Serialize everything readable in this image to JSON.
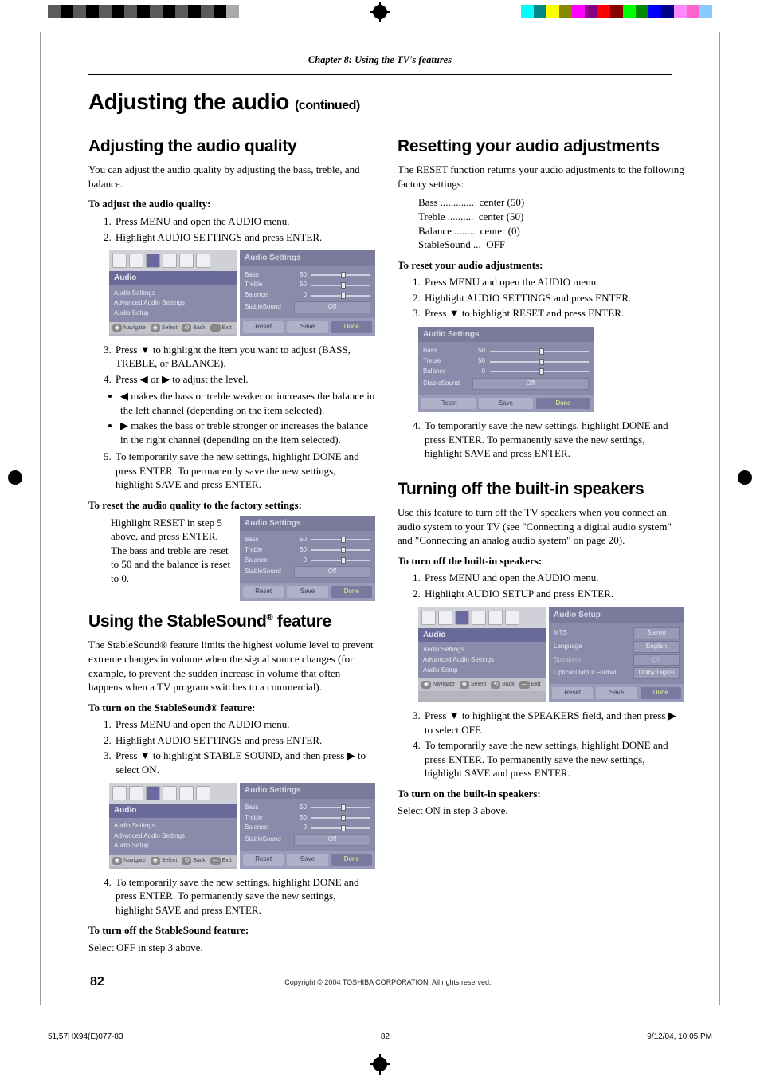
{
  "chapter_label": "Chapter 8: Using the TV's features",
  "page_title": "Adjusting the audio",
  "page_title_cont": "(continued)",
  "left": {
    "sec1_title": "Adjusting the audio quality",
    "intro": "You can adjust the audio quality by adjusting the bass, treble, and balance.",
    "lead1": "To adjust the audio quality:",
    "s1": "Press MENU and open the AUDIO menu.",
    "s2": "Highlight AUDIO SETTINGS and press ENTER.",
    "s3": "Press ▼ to highlight the item you want to adjust (BASS, TREBLE, or BALANCE).",
    "s4": "Press ◀ or ▶ to adjust the level.",
    "b1": "◀ makes the bass or treble weaker or increases the balance in the left channel (depending on the item selected).",
    "b2": "▶ makes the bass or treble stronger or increases the balance in the right channel (depending on the item selected).",
    "s5": "To temporarily save the new settings, highlight DONE and press ENTER. To permanently save the new settings, highlight SAVE and press ENTER.",
    "lead2": "To reset the audio quality to the factory settings:",
    "reset_text": "Highlight RESET in step 5 above, and press ENTER.\nThe bass and treble are reset to 50 and the balance is reset to 0.",
    "sec2_title_a": "Using the StableSound",
    "sec2_title_b": " feature",
    "ss_intro": "The StableSound® feature limits the highest volume level to prevent extreme changes in volume when the signal source changes (for example, to prevent the sudden increase in volume that often happens when a TV program switches to a commercial).",
    "ss_on_lead": "To turn on the StableSound® feature:",
    "ss1": "Press MENU and open the AUDIO menu.",
    "ss2": "Highlight AUDIO SETTINGS and press ENTER.",
    "ss3": "Press ▼ to highlight STABLE SOUND, and then press ▶ to select ON.",
    "ss4": "To temporarily save the new settings, highlight DONE and press ENTER. To permanently save the new settings, highlight SAVE and press ENTER.",
    "ss_off_lead": "To turn off the StableSound feature:",
    "ss_off_text": "Select OFF in step 3 above."
  },
  "right": {
    "sec1_title": "Resetting your audio adjustments",
    "intro": "The RESET function returns your audio adjustments to the following factory settings:",
    "d1": "Bass .............  center (50)",
    "d2": "Treble ..........  center (50)",
    "d3": "Balance ........  center (0)",
    "d4": "StableSound ...  OFF",
    "lead1": "To reset your audio adjustments:",
    "s1": "Press MENU and open the AUDIO menu.",
    "s2": "Highlight AUDIO SETTINGS and press ENTER.",
    "s3": "Press ▼ to highlight RESET and press ENTER.",
    "s4": "To temporarily save the new settings, highlight DONE and press ENTER. To permanently save the new settings, highlight SAVE and press ENTER.",
    "sec2_title": "Turning off the built-in speakers",
    "sp_intro": "Use this feature to turn off the TV speakers when you connect an audio system to your TV (see \"Connecting a digital audio system\" and \"Connecting an analog audio system\" on page 20).",
    "sp_lead": "To turn off the built-in speakers:",
    "sp1": "Press MENU and open the AUDIO menu.",
    "sp2": "Highlight AUDIO SETUP and press ENTER.",
    "sp3": "Press ▼ to highlight the SPEAKERS field, and then press ▶ to select OFF.",
    "sp4": "To temporarily save the new settings, highlight DONE and press ENTER. To permanently save the new settings, highlight SAVE and press ENTER.",
    "sp_on_lead": "To turn on the built-in speakers:",
    "sp_on_text": "Select ON in step 3 above."
  },
  "osd": {
    "menu_cat": "Audio",
    "menu_i1": "Audio Settings",
    "menu_i2": "Advanced Audio Settings",
    "menu_i3": "Audio Setup",
    "nav": "Navigate",
    "sel": "Select",
    "back": "Back",
    "exit": "Exit",
    "sp_title": "Audio Settings",
    "bass": "Bass",
    "bass_v": "50",
    "treble": "Treble",
    "treble_v": "50",
    "balance": "Balance",
    "balance_v": "0",
    "ss": "StableSound",
    "ss_off": "Off",
    "reset": "Reset",
    "save": "Save",
    "done": "Done",
    "setup_title": "Audio Setup",
    "mts": "MTS",
    "mts_v": "Stereo",
    "lang": "Language",
    "lang_v": "English",
    "speakers": "Speakers",
    "speakers_v": "Off",
    "opt": "Optical Output Format",
    "opt_v": "Dolby Digital"
  },
  "page_number": "82",
  "copyright": "Copyright © 2004 TOSHIBA CORPORATION. All rights reserved.",
  "slug_left": "51,57HX94(E)077-83",
  "slug_mid": "82",
  "slug_right": "9/12/04, 10:05 PM"
}
